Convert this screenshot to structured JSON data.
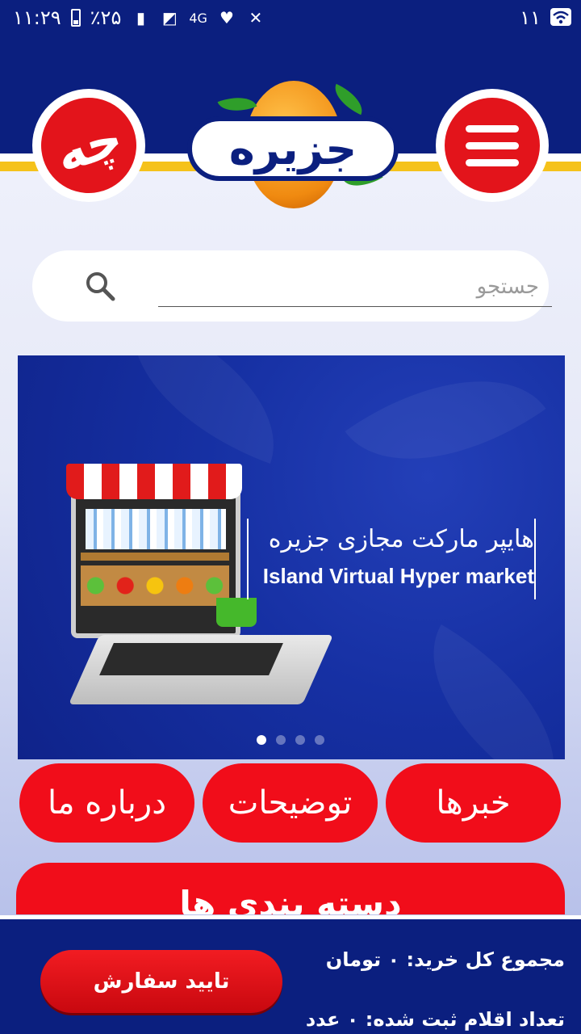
{
  "status_bar": {
    "time": "۱۱:۲۹",
    "battery": "٪۲۵",
    "network": "4G",
    "right_number": "۱۱"
  },
  "header": {
    "logo_text": "جزیره",
    "chat_label": "چه",
    "menu_icon": "hamburger-menu-icon"
  },
  "search": {
    "placeholder": "جستجو",
    "value": ""
  },
  "banner": {
    "title_fa": "هایپر مارکت مجازی جزیره",
    "title_en": "Island Virtual Hyper market",
    "slides_count": 4,
    "active_slide": 1
  },
  "nav_buttons": {
    "news": "خبرها",
    "descriptions": "توضیحات",
    "about": "درباره ما"
  },
  "categories_label": "دسته بندی ها",
  "footer": {
    "total_label": "مجموع کل خرید:",
    "total_value": "۰",
    "total_unit": "تومان",
    "items_label": "تعداد اقلام ثبت شده:",
    "items_value": "۰",
    "items_unit": "عدد",
    "confirm_button": "تایید سفارش"
  },
  "colors": {
    "primary_blue": "#0b1f7f",
    "accent_red": "#f10d1a",
    "stripe_yellow": "#f5c21b"
  }
}
